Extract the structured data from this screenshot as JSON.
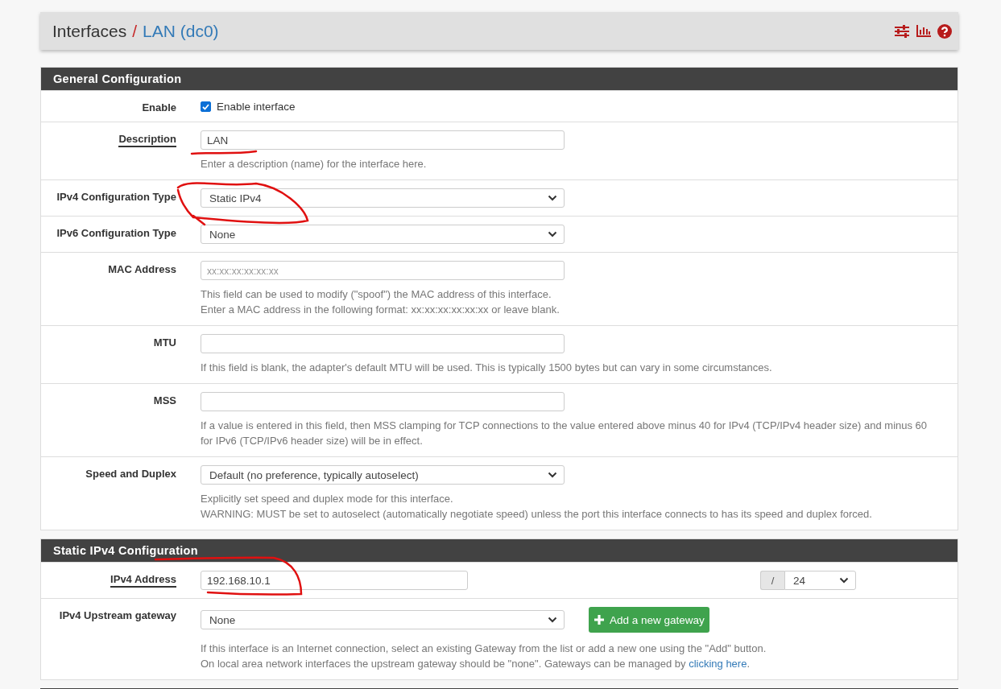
{
  "breadcrumb": {
    "section": "Interfaces",
    "separator": "/",
    "current": "LAN (dc0)"
  },
  "toolbar_icons": [
    {
      "kind": "settings"
    },
    {
      "kind": "chart"
    },
    {
      "kind": "help"
    }
  ],
  "general_configuration": {
    "title": "General Configuration",
    "rows": [
      {
        "kind": "checkbox",
        "label": "Enable",
        "has_help": false,
        "checked": true,
        "option": "Enable interface",
        "help": []
      },
      {
        "kind": "text",
        "label": "Description",
        "has_help": true,
        "value": "LAN",
        "help": [
          "Enter a description (name) for the interface here."
        ]
      },
      {
        "kind": "select",
        "label": "IPv4 Configuration Type",
        "has_help": false,
        "value": "Static IPv4",
        "help": []
      },
      {
        "kind": "select",
        "label": "IPv6 Configuration Type",
        "has_help": false,
        "value": "None",
        "help": []
      },
      {
        "kind": "text",
        "label": "MAC Address",
        "has_help": false,
        "placeholder": "xx:xx:xx:xx:xx:xx",
        "help": [
          "This field can be used to modify (\"spoof\") the MAC address of this interface.",
          "Enter a MAC address in the following format: xx:xx:xx:xx:xx:xx or leave blank."
        ]
      },
      {
        "kind": "text",
        "label": "MTU",
        "has_help": false,
        "help": [
          "If this field is blank, the adapter's default MTU will be used. This is typically 1500 bytes but can vary in some circumstances."
        ]
      },
      {
        "kind": "text",
        "label": "MSS",
        "has_help": false,
        "help": [
          "If a value is entered in this field, then MSS clamping for TCP connections to the value entered above minus 40 for IPv4 (TCP/IPv4 header size) and minus 60 for IPv6 (TCP/IPv6 header size) will be in effect."
        ]
      },
      {
        "kind": "select",
        "label": "Speed and Duplex",
        "has_help": false,
        "value": "Default (no preference, typically autoselect)",
        "help": [
          "Explicitly set speed and duplex mode for this interface.",
          "WARNING: MUST be set to autoselect (automatically negotiate speed) unless the port this interface connects to has its speed and duplex forced."
        ]
      }
    ]
  },
  "static_ipv4_configuration": {
    "title": "Static IPv4 Configuration",
    "rows": [
      {
        "kind": "address",
        "label": "IPv4 Address",
        "has_help": true,
        "value": "192.168.10.1",
        "prefix_separator": "/",
        "prefix": "24",
        "help": []
      },
      {
        "kind": "gateway",
        "label": "IPv4 Upstream gateway",
        "has_help": false,
        "value": "None",
        "button": "Add a new gateway",
        "help": [
          "If this interface is an Internet connection, select an existing Gateway from the list or add a new one using the \"Add\" button.",
          {
            "text": "On local area network interfaces the upstream gateway should be \"none\". Gateways can be managed by ",
            "link": "clicking here",
            "tail": "."
          }
        ]
      }
    ]
  },
  "annotations": [
    {
      "kind": "underline"
    },
    {
      "kind": "loop"
    },
    {
      "kind": "hook"
    }
  ]
}
